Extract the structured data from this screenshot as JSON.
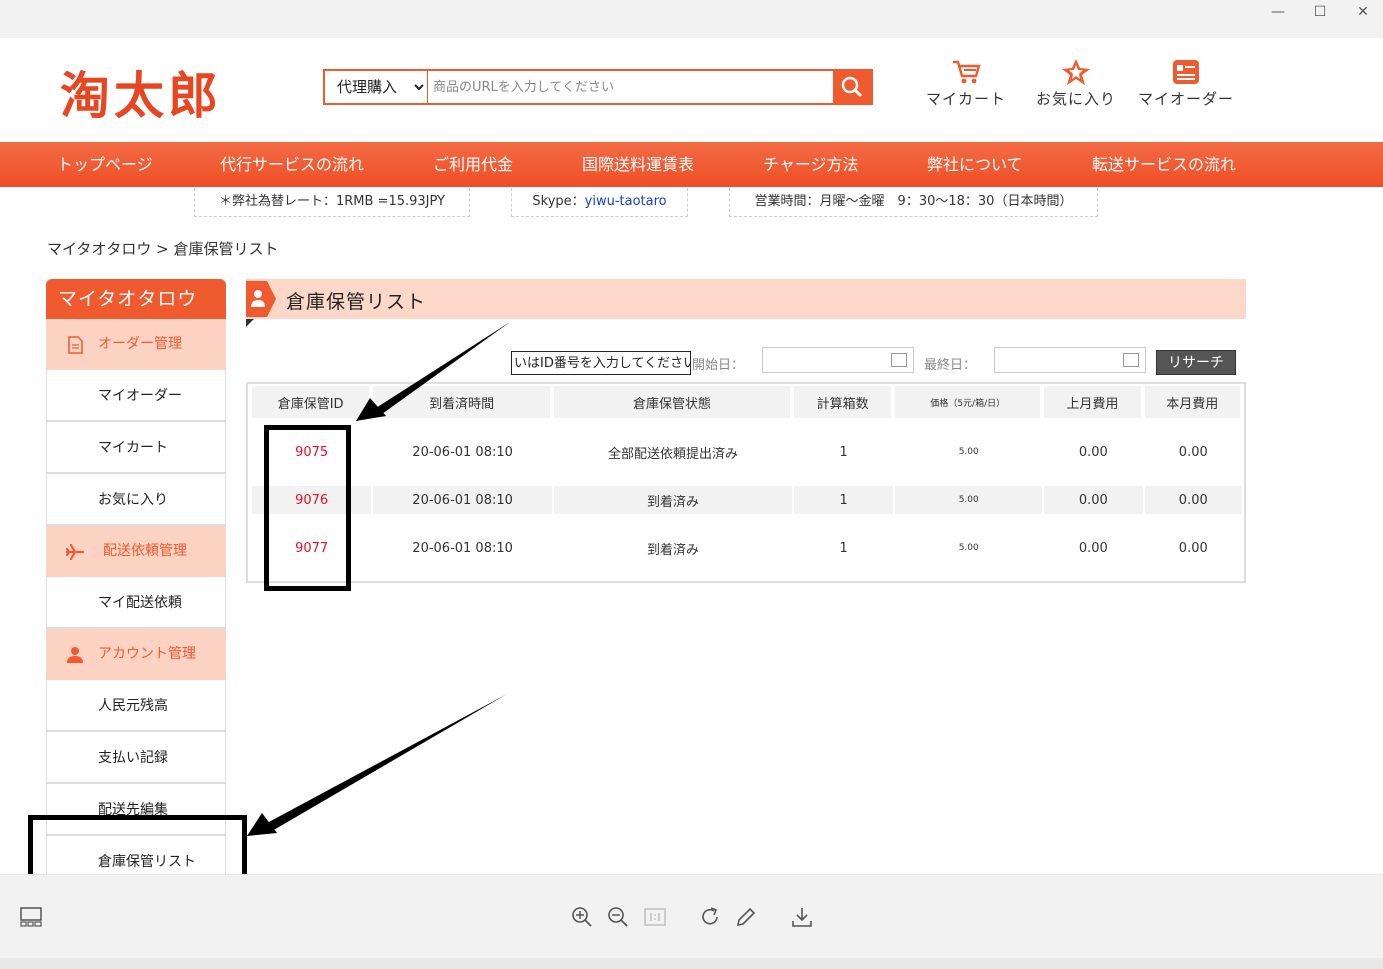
{
  "window": {
    "minimize": "—",
    "maximize": "☐",
    "close": "✕"
  },
  "header": {
    "logo": "淘太郎",
    "search_select": "代理購入",
    "search_placeholder": "商品のURLを入力してください",
    "links": [
      "マイカート",
      "お気に入り",
      "マイオーダー"
    ]
  },
  "nav": [
    "トップページ",
    "代行サービスの流れ",
    "ご利用代金",
    "国際送料運賃表",
    "チャージ方法",
    "弊社について",
    "転送サービスの流れ"
  ],
  "info": {
    "rate": "＊弊社為替レート：1RMB =15.93JPY",
    "skype_label": "Skype：",
    "skype_id": "yiwu-taotaro",
    "hours": "営業時間：月曜～金曜　9：30～18：30（日本時間）"
  },
  "breadcrumb": "マイタオタロウ > 倉庫保管リスト",
  "sidebar": {
    "title": "マイタオタロウ",
    "sections": [
      {
        "label": "オーダー管理",
        "items": [
          "マイオーダー",
          "マイカート",
          "お気に入り"
        ]
      },
      {
        "label": "配送依頼管理",
        "items": [
          "マイ配送依頼"
        ]
      },
      {
        "label": "アカウント管理",
        "items": [
          "人民元残高",
          "支払い記録",
          "配送先編集",
          "倉庫保管リスト"
        ]
      }
    ]
  },
  "main": {
    "title": "倉庫保管リスト",
    "filter_placeholder": "いはID番号を入力してください",
    "start_label": "開始日：",
    "end_label": "最終日：",
    "search_button": "リサーチ",
    "columns": [
      "倉庫保管ID",
      "到着済時間",
      "倉庫保管状態",
      "計算箱数",
      "価格（5元/箱/日）",
      "上月費用",
      "本月費用"
    ],
    "rows": [
      [
        "9075",
        "20-06-01 08:10",
        "全部配送依頼提出済み",
        "1",
        "5.00",
        "0.00",
        "0.00"
      ],
      [
        "9076",
        "20-06-01 08:10",
        "到着済み",
        "1",
        "5.00",
        "0.00",
        "0.00"
      ],
      [
        "9077",
        "20-06-01 08:10",
        "到着済み",
        "1",
        "5.00",
        "0.00",
        "0.00"
      ]
    ]
  },
  "colors": {
    "brand": "#ef5a2f",
    "brand_light": "#fcd3c3",
    "id_red": "#e0102a",
    "annotation": "#000000"
  }
}
